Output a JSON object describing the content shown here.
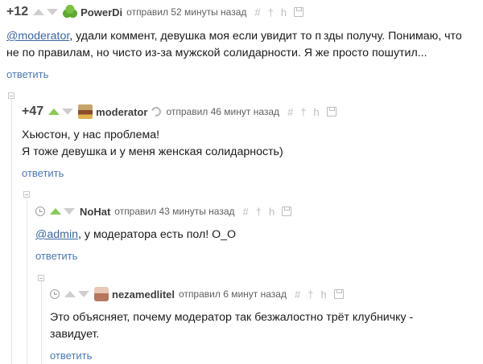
{
  "comments": [
    {
      "rating": "+12",
      "author": "PowerDi",
      "meta": "отправил 52 минуты назад",
      "body_mention": "@moderator",
      "body_text": ", удали коммент, девушка моя если увидит то п зды получу. Понимаю, что не по правилам, но чисто из-за мужской солидарности. Я же просто пошутил...",
      "reply": "ответить"
    },
    {
      "rating": "+47",
      "author": "moderator",
      "meta": "отправил 46 минут назад",
      "body_line1": "Хьюстон, у нас проблема!",
      "body_line2": "Я тоже девушка и у меня женская солидарность)",
      "reply": "ответить"
    },
    {
      "author": "NoHat",
      "meta": "отправил 43 минуты назад",
      "body_mention": "@admin",
      "body_text": ", у модератора есть пол! О_О",
      "reply": "ответить"
    },
    {
      "author": "nezamedlitel",
      "meta": "отправил 6 минут назад",
      "body_text": "Это объясняет, почему модератор так безжалостно трёт клубничку - завидует.",
      "reply": "ответить"
    }
  ],
  "tools": {
    "link": "#",
    "pin": "†",
    "tree": "h"
  }
}
